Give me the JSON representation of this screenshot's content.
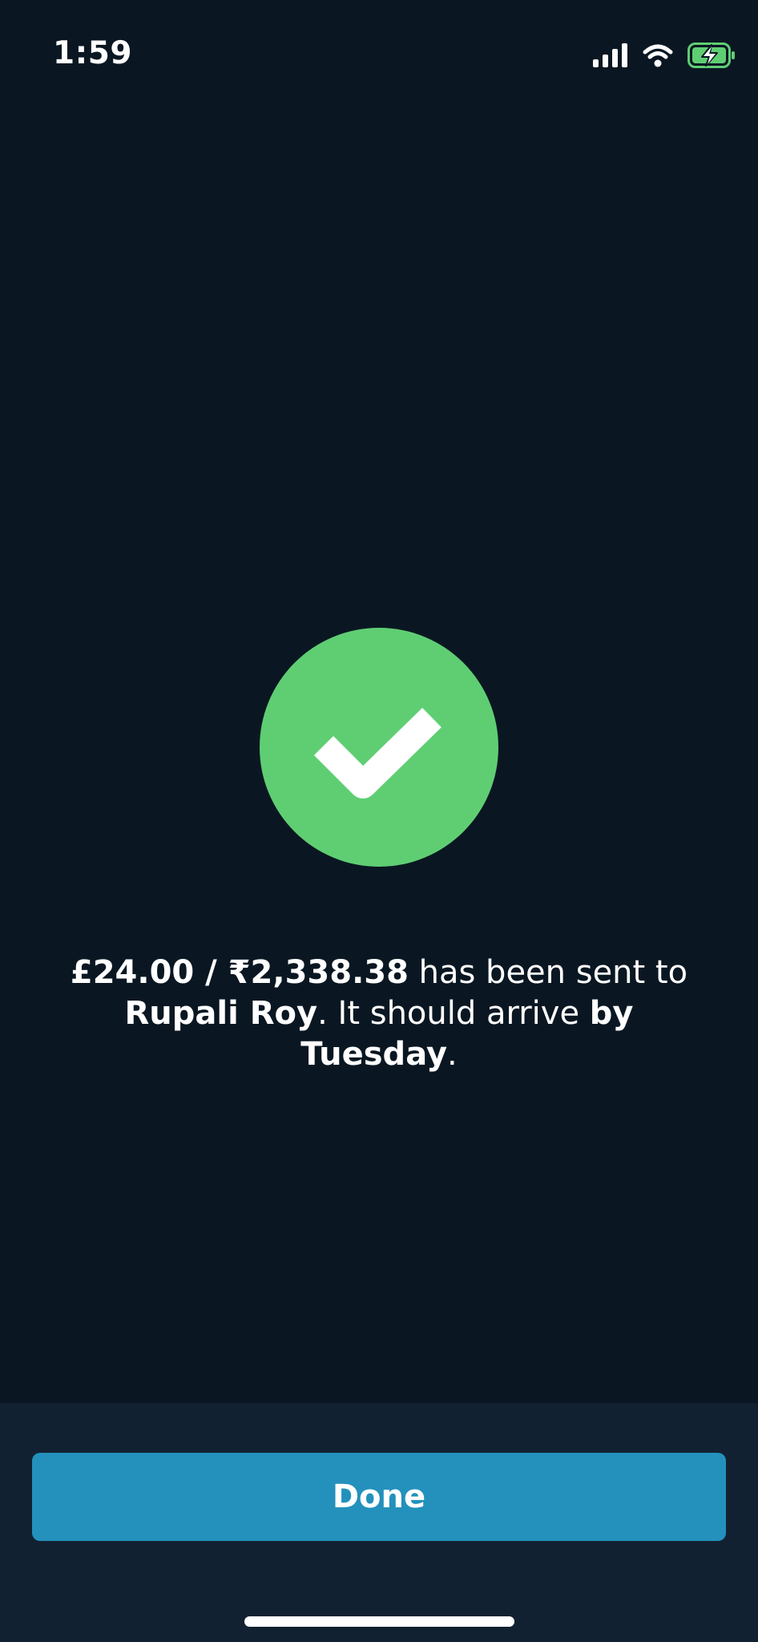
{
  "status_bar": {
    "time": "1:59",
    "icons": [
      "cellular-signal-icon",
      "wifi-icon",
      "battery-charging-icon"
    ]
  },
  "success": {
    "icon": "checkmark-icon",
    "badge_color": "#5fce73",
    "amount": "£24.00 / ₹2,338.38",
    "sent_text": " has been sent to ",
    "recipient": "Rupali Roy",
    "arrive_text": ". It should arrive ",
    "by_label": "by Tuesday",
    "end_punct": "."
  },
  "footer": {
    "done_label": "Done",
    "button_color": "#2391bc"
  }
}
